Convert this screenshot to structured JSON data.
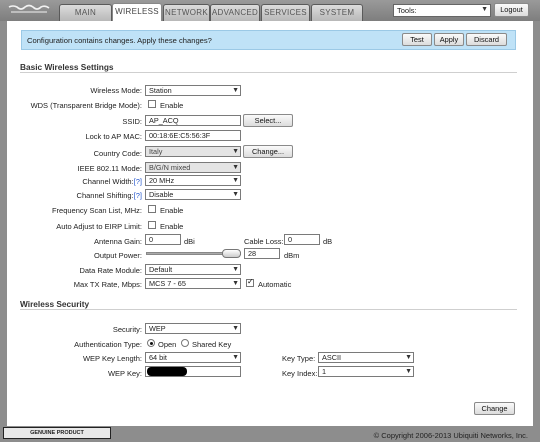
{
  "nav": {
    "tabs": [
      {
        "label": "MAIN"
      },
      {
        "label": "WIRELESS"
      },
      {
        "label": "NETWORK"
      },
      {
        "label": "ADVANCED"
      },
      {
        "label": "SERVICES"
      },
      {
        "label": "SYSTEM"
      }
    ],
    "tools_value": "Tools:",
    "logout_label": "Logout"
  },
  "notice": {
    "text": "Configuration contains changes. Apply these changes?",
    "test_label": "Test",
    "apply_label": "Apply",
    "discard_label": "Discard"
  },
  "basic": {
    "title": "Basic Wireless Settings",
    "wireless_mode": {
      "label": "Wireless Mode:",
      "value": "Station"
    },
    "wds": {
      "label": "WDS (Transparent Bridge Mode):",
      "option": "Enable",
      "checked": false
    },
    "ssid": {
      "label": "SSID:",
      "value": "AP_ACQ",
      "button": "Select..."
    },
    "lock_mac": {
      "label": "Lock to AP MAC:",
      "value": "00:18:6E:C5:56:3F"
    },
    "country": {
      "label": "Country Code:",
      "value": "Italy",
      "button": "Change..."
    },
    "ieee_mode": {
      "label": "IEEE 802.11 Mode:",
      "value": "B/G/N mixed"
    },
    "channel_width": {
      "label": "Channel Width:",
      "help": "[?]",
      "value": "20 MHz"
    },
    "channel_shifting": {
      "label": "Channel Shifting:",
      "help": "[?]",
      "value": "Disable"
    },
    "freq_scan": {
      "label": "Frequency Scan List, MHz:",
      "option": "Enable",
      "checked": false
    },
    "auto_eirp": {
      "label": "Auto Adjust to EIRP Limit:",
      "option": "Enable",
      "checked": false
    },
    "antenna_gain": {
      "label": "Antenna Gain:",
      "value": "0",
      "unit": "dBi"
    },
    "cable_loss": {
      "label": "Cable Loss:",
      "value": "0",
      "unit": "dB"
    },
    "output_power": {
      "label": "Output Power:",
      "value": "28",
      "unit": "dBm",
      "level": 1.0
    },
    "data_rate": {
      "label": "Data Rate Module:",
      "value": "Default"
    },
    "max_tx": {
      "label": "Max TX Rate, Mbps:",
      "value": "MCS 7 - 65",
      "auto_label": "Automatic",
      "auto_checked": true
    }
  },
  "security": {
    "title": "Wireless Security",
    "security": {
      "label": "Security:",
      "value": "WEP"
    },
    "auth_type": {
      "label": "Authentication Type:",
      "options": [
        "Open",
        "Shared Key"
      ],
      "selected": "Open"
    },
    "key_length": {
      "label": "WEP Key Length:",
      "value": "64 bit"
    },
    "key_type": {
      "label": "Key Type:",
      "value": "ASCII"
    },
    "wep_key": {
      "label": "WEP Key:"
    },
    "key_index": {
      "label": "Key Index:",
      "value": "1"
    }
  },
  "change_label": "Change",
  "footer": {
    "badge": "GENUINE  PRODUCT",
    "copyright": "© Copyright 2006-2013 Ubiquiti Networks, Inc."
  }
}
